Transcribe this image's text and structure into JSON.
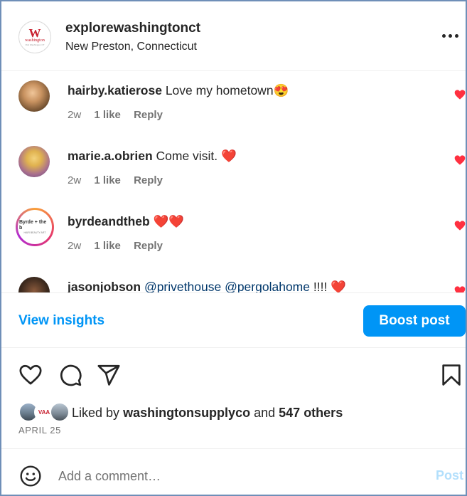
{
  "header": {
    "account_name": "explorewashingtonct",
    "location": "New Preston, Connecticut",
    "avatar_logo": {
      "mark": "W",
      "text": "washington",
      "subtext": "Visit Washington CT"
    }
  },
  "comments": [
    {
      "username": "hairby.katierose",
      "text": "Love my hometown",
      "emoji": "😍",
      "time": "2w",
      "likes": "1 like",
      "reply": "Reply"
    },
    {
      "username": "marie.a.obrien",
      "text": "Come visit.",
      "emoji": "❤️",
      "time": "2w",
      "likes": "1 like",
      "reply": "Reply"
    },
    {
      "username": "byrdeandtheb",
      "text": "",
      "emoji": "❤️❤️",
      "time": "2w",
      "likes": "1 like",
      "reply": "Reply",
      "avatar_logo": {
        "line1": "Byrde + the b",
        "line2": "HAIR BEAUTY ART"
      }
    },
    {
      "username": "jasonjobson",
      "mentions": [
        "@privethouse",
        "@pergolahome"
      ],
      "text": "!!!!",
      "emoji": "❤️"
    }
  ],
  "insights": {
    "view_label": "View insights",
    "boost_label": "Boost post"
  },
  "likes": {
    "liked_by_prefix": "Liked by",
    "liked_by_user": "washingtonsupplyco",
    "and_word": "and",
    "others": "547 others",
    "avatar2_text": "VAA"
  },
  "date": "APRIL 25",
  "comment_box": {
    "placeholder": "Add a comment…",
    "post_label": "Post"
  },
  "colors": {
    "accent": "#0095f6",
    "heart": "#ff3040",
    "post_disabled": "#b2dffc",
    "text": "#262626",
    "muted": "#737373"
  },
  "icons": [
    "more-icon",
    "heart-icon",
    "comment-icon",
    "share-icon",
    "bookmark-icon",
    "emoji-icon"
  ]
}
